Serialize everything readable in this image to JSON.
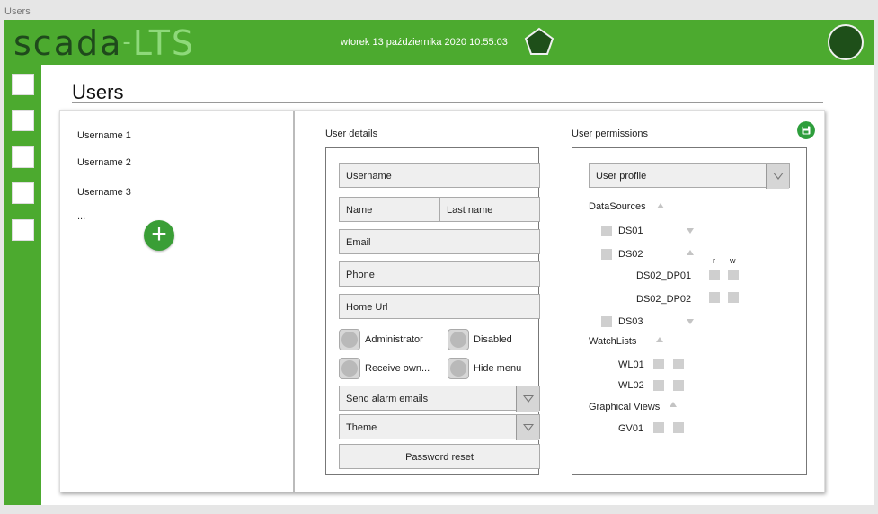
{
  "window": {
    "title": "Users"
  },
  "header": {
    "logo_primary": "SCADA",
    "logo_secondary": "LTS",
    "datetime": "wtorek 13 października 2020 10:55:03"
  },
  "colors": {
    "brand_green": "#4caa2f",
    "logo_dark": "#1f4a1c",
    "avatar": "#1e4f19"
  },
  "page": {
    "title": "Users"
  },
  "users": {
    "items": [
      "Username 1",
      "Username 2",
      "Username 3",
      "..."
    ],
    "add_icon": "plus-icon"
  },
  "user_details": {
    "label": "User details",
    "username_placeholder": "Username",
    "name_placeholder": "Name",
    "lastname_placeholder": "Last name",
    "email_placeholder": "Email",
    "phone_placeholder": "Phone",
    "homeurl_placeholder": "Home Url",
    "toggles": {
      "administrator": "Administrator",
      "disabled": "Disabled",
      "receive_own": "Receive own...",
      "hide_menu": "Hide menu"
    },
    "send_alarm_emails": "Send alarm emails",
    "theme": "Theme",
    "password_reset": "Password reset"
  },
  "user_permissions": {
    "label": "User permissions",
    "profile_select": "User profile",
    "datasources_label": "DataSources",
    "ds01": "DS01",
    "ds02": "DS02",
    "ds03": "DS03",
    "col_r": "r",
    "col_w": "w",
    "ds02_dp01": "DS02_DP01",
    "ds02_dp02": "DS02_DP02",
    "watchlists_label": "WatchLists",
    "wl01": "WL01",
    "wl02": "WL02",
    "graphical_views_label": "Graphical Views",
    "gv01": "GV01"
  }
}
